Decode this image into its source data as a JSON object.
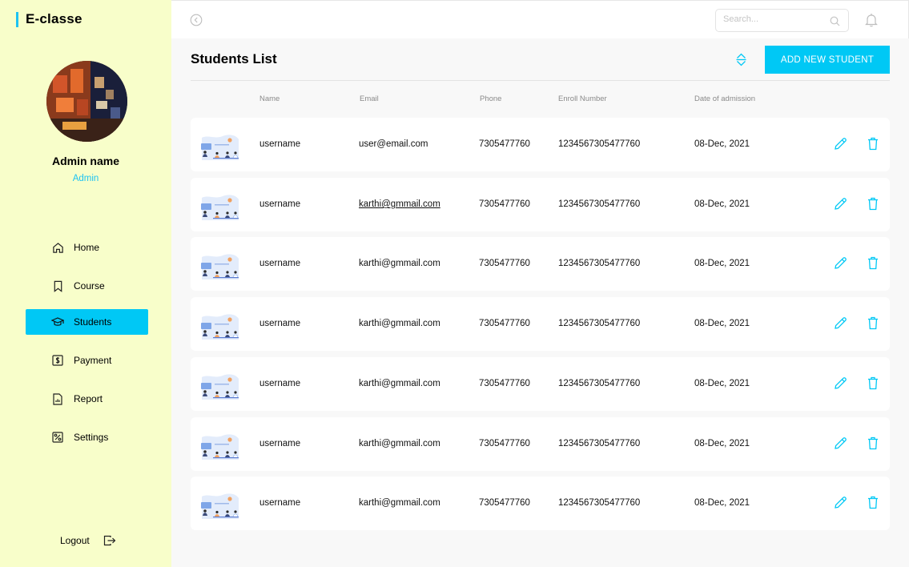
{
  "app": {
    "brand": "E-classe"
  },
  "profile": {
    "name": "Admin name",
    "role": "Admin"
  },
  "sidebar": {
    "items": [
      {
        "label": "Home",
        "icon": "home-icon",
        "active": false
      },
      {
        "label": "Course",
        "icon": "bookmark-icon",
        "active": false
      },
      {
        "label": "Students",
        "icon": "graduation-cap-icon",
        "active": true
      },
      {
        "label": "Payment",
        "icon": "dollar-icon",
        "active": false
      },
      {
        "label": "Report",
        "icon": "report-icon",
        "active": false
      },
      {
        "label": "Settings",
        "icon": "percent-settings-icon",
        "active": false
      }
    ],
    "logout_label": "Logout"
  },
  "topbar": {
    "search_placeholder": "Search..."
  },
  "main": {
    "title": "Students List",
    "add_button_label": "ADD NEW STUDENT",
    "columns": [
      "Name",
      "Email",
      "Phone",
      "Enroll Number",
      "Date of admission"
    ],
    "rows": [
      {
        "name": "username",
        "email": "user@email.com",
        "phone": "7305477760",
        "enroll": "1234567305477760",
        "date": "08-Dec, 2021",
        "email_underlined": false
      },
      {
        "name": "username",
        "email": "karthi@gmmail.com",
        "phone": "7305477760",
        "enroll": "1234567305477760",
        "date": "08-Dec, 2021",
        "email_underlined": true
      },
      {
        "name": "username",
        "email": "karthi@gmmail.com",
        "phone": "7305477760",
        "enroll": "1234567305477760",
        "date": "08-Dec, 2021",
        "email_underlined": false
      },
      {
        "name": "username",
        "email": "karthi@gmmail.com",
        "phone": "7305477760",
        "enroll": "1234567305477760",
        "date": "08-Dec, 2021",
        "email_underlined": false
      },
      {
        "name": "username",
        "email": "karthi@gmmail.com",
        "phone": "7305477760",
        "enroll": "1234567305477760",
        "date": "08-Dec, 2021",
        "email_underlined": false
      },
      {
        "name": "username",
        "email": "karthi@gmmail.com",
        "phone": "7305477760",
        "enroll": "1234567305477760",
        "date": "08-Dec, 2021",
        "email_underlined": false
      },
      {
        "name": "username",
        "email": "karthi@gmmail.com",
        "phone": "7305477760",
        "enroll": "1234567305477760",
        "date": "08-Dec, 2021",
        "email_underlined": false
      }
    ]
  },
  "colors": {
    "accent": "#00c8f5",
    "sidebar_bg": "#f8feca",
    "page_bg": "#f8f8f8"
  }
}
